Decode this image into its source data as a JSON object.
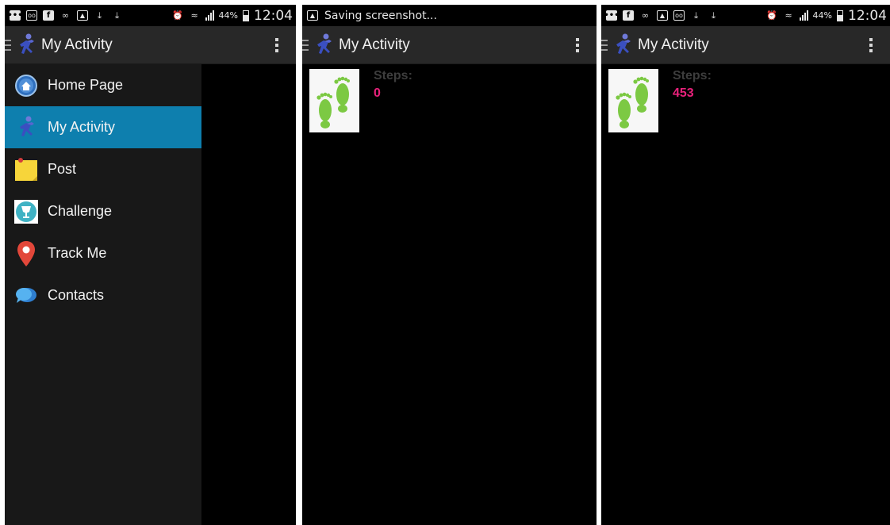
{
  "screens": [
    {
      "status": {
        "battery": "44%",
        "time": "12:04"
      },
      "action_bar": {
        "title": "My Activity"
      },
      "drawer": {
        "items": [
          {
            "label": "Home Page",
            "icon": "home-icon"
          },
          {
            "label": "My Activity",
            "icon": "runner-icon",
            "selected": true
          },
          {
            "label": "Post",
            "icon": "sticky-note-icon"
          },
          {
            "label": "Challenge",
            "icon": "trophy-icon"
          },
          {
            "label": "Track Me",
            "icon": "map-pin-icon"
          },
          {
            "label": "Contacts",
            "icon": "chat-bubbles-icon"
          }
        ]
      }
    },
    {
      "status": {
        "message": "Saving screenshot..."
      },
      "action_bar": {
        "title": "My Activity"
      },
      "activity": {
        "steps_label": "Steps:",
        "steps_value": "0"
      }
    },
    {
      "status": {
        "battery": "44%",
        "time": "12:04"
      },
      "action_bar": {
        "title": "My Activity"
      },
      "activity": {
        "steps_label": "Steps:",
        "steps_value": "453"
      }
    }
  ],
  "colors": {
    "selected_item": "#0e7fae",
    "steps_value": "#e9217b",
    "action_bar": "#282828",
    "drawer_bg": "#181818"
  }
}
